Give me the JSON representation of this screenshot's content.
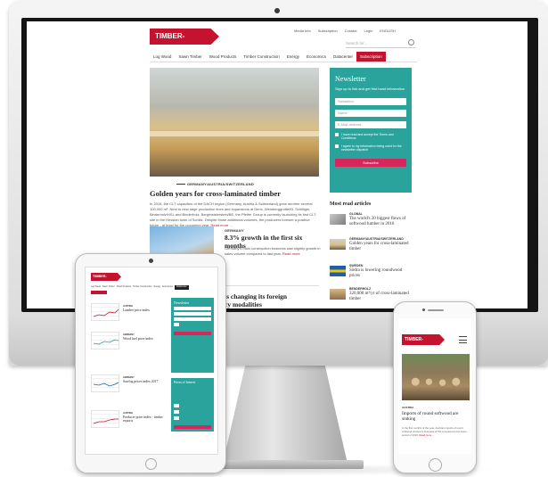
{
  "desktop": {
    "logo": {
      "main": "TIMBER-ONLINE",
      "tld": ".net"
    },
    "topbar": [
      "Media Info",
      "Subscription",
      "Contact",
      "Login",
      "ENGLISH"
    ],
    "search_placeholder": "Search for...",
    "nav": [
      "Log Wood",
      "Sawn Timber",
      "Wood Products",
      "Timber Construction",
      "Energy",
      "Economics",
      "Datacenter",
      "Subscription"
    ],
    "lead": {
      "kicker": "GERMANY/AUSTRIA/SWITZERLAND",
      "headline": "Golden years for cross-laminated timber",
      "body": "In 2016, the CLT capacities of the DACH region (Germany, Austria & Switzerland) grew another several 100,000 m³. Next to new large production lines and expansions at Derix, Weinberggrotte/KL Schilliger, Binderholz/HSL and Binderholz, Bergmeisterstein/BE, the Pfeifer Group is currently launching its first CLT site in the Hessian town of Schlitz. Despite those additional volumes, the producers foresee a positive future - at least for the upcoming year.",
      "more": "Read more ..."
    },
    "second": {
      "kicker": "GERMANY",
      "headline": "8.3% growth in the first six months",
      "body": "Germany's main construction business saw slightly growth in sales volume compared to last year.",
      "more": "Read more"
    },
    "third": {
      "headline_line1": "is changing its foreign",
      "headline_line2": "cy modalities"
    },
    "newsletter": {
      "title": "Newsletter",
      "subtitle": "Sign up to link and get first hand information",
      "salutation": "Salutation",
      "name": "Name",
      "email": "E-Mail address",
      "terms": "I have read and accept the Terms and Conditions",
      "consent": "I agree to my information being used for the newsletter dispatch",
      "button": "Subscribe"
    },
    "most_read": {
      "title": "Most read articles",
      "items": [
        {
          "kicker": "GLOBAL",
          "title": "The world's 20 biggest flows of softwood lumber in 2016"
        },
        {
          "kicker": "GERMANY/AUSTRIA/SWITZERLAND",
          "title": "Golden years for cross-laminated timber"
        },
        {
          "kicker": "SWEDEN",
          "title": "Södra is lowering roundwood prices"
        },
        {
          "kicker": "BENDERHOLZ",
          "title": "320,000 m³/yr of cross-laminated timber"
        }
      ]
    }
  },
  "tablet": {
    "logo": "TIMBER-ONLINE.net",
    "nav": [
      "Log Wood",
      "Sawn Timber",
      "Wood Products",
      "Timber Construction",
      "Energy",
      "Economics",
      "Datacenter"
    ],
    "articles": [
      {
        "kicker": "AUSTRIA",
        "title": "Lumber price index"
      },
      {
        "kicker": "GERMANY",
        "title": "Wood fuel price index"
      },
      {
        "kicker": "GERMANY",
        "title": "Sawlog prices index 2017"
      },
      {
        "kicker": "AUSTRIA",
        "title": "Producer price index - timber exports"
      }
    ],
    "newsletter_title": "Newsletter",
    "second_title": "Prices of Interest"
  },
  "phone": {
    "logo": {
      "main": "TIMBER-ONLINE",
      "tld": ".net"
    },
    "kicker": "AUSTRIA",
    "headline": "Imports of round softwood are sinking",
    "body": "In the first months of the year, Austrian imports of round softwood showed a decrease of 5% compared to the same period of 2016.",
    "more": "Read more ..."
  },
  "colors": {
    "brand_red": "#c4122f",
    "newsletter_teal": "#2ba39d",
    "button_pink": "#d6265a"
  }
}
